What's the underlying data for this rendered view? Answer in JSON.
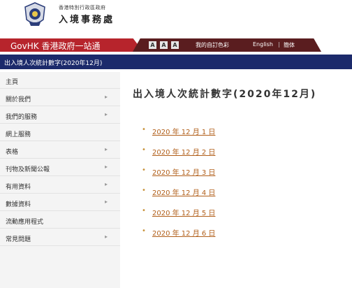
{
  "header": {
    "dept_small": "香港特別行政區政府",
    "dept_name": "入境事務處"
  },
  "govbar": {
    "brand": "GovHK 香港政府一站通",
    "font_buttons": [
      "A",
      "A",
      "A"
    ],
    "custom_colour": "我的自訂色彩",
    "english": "English",
    "separator": "|",
    "simplified": "簡体"
  },
  "breadcrumb": {
    "text": "出入境人次統計數字(2020年12月)"
  },
  "sidebar": {
    "items": [
      {
        "label": "主頁",
        "arrow": ""
      },
      {
        "label": "關於我們",
        "arrow": "▸"
      },
      {
        "label": "我們的服務",
        "arrow": "▸"
      },
      {
        "label": "網上服務",
        "arrow": ""
      },
      {
        "label": "表格",
        "arrow": "▸"
      },
      {
        "label": "刊物及新聞公報",
        "arrow": "▸"
      },
      {
        "label": "有用資料",
        "arrow": "▸"
      },
      {
        "label": "數據資料",
        "arrow": "▸"
      },
      {
        "label": "流動應用程式",
        "arrow": ""
      },
      {
        "label": "常見問題",
        "arrow": "▸"
      }
    ]
  },
  "main": {
    "title": "出入境人次統計數字(2020年12月)",
    "bullet": "•",
    "dates": [
      "2020 年 12 月 1 日",
      "2020 年 12 月 2 日",
      "2020 年 12 月 3 日",
      "2020 年 12 月 4 日",
      "2020 年 12 月 5 日",
      "2020 年 12 月 6 日"
    ]
  },
  "colors": {
    "gov_red": "#b7242c",
    "nav_blue": "#1c2a6b",
    "link_orange": "#b15f1a"
  }
}
